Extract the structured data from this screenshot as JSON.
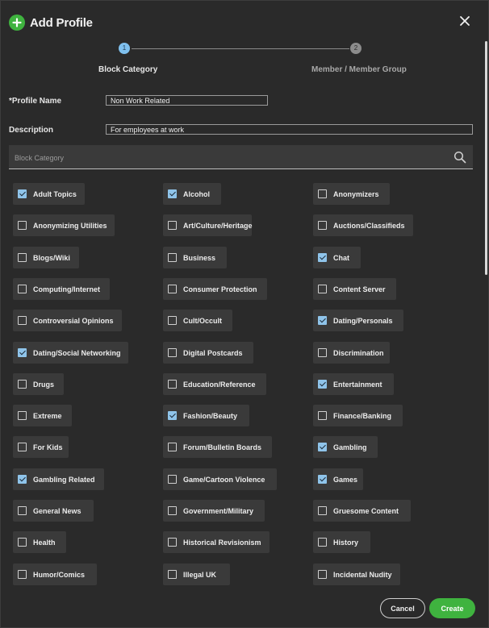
{
  "header": {
    "title": "Add Profile",
    "icon": "plus-icon",
    "accent": "#3fb33f"
  },
  "stepper": {
    "steps": [
      {
        "number": "1",
        "label": "Block Category",
        "active": true
      },
      {
        "number": "2",
        "label": "Member / Member Group",
        "active": false
      }
    ]
  },
  "form": {
    "profile_name_label": "*Profile Name",
    "profile_name_value": "Non Work Related",
    "description_label": "Description",
    "description_value": "For employees at work",
    "search_placeholder": "Block Category"
  },
  "categories": [
    {
      "label": "Adult Topics",
      "checked": true
    },
    {
      "label": "Alcohol",
      "checked": true
    },
    {
      "label": "Anonymizers",
      "checked": false
    },
    {
      "label": "Anonymizing Utilities",
      "checked": false
    },
    {
      "label": "Art/Culture/Heritage",
      "checked": false
    },
    {
      "label": "Auctions/Classifieds",
      "checked": false
    },
    {
      "label": "Blogs/Wiki",
      "checked": false
    },
    {
      "label": "Business",
      "checked": false
    },
    {
      "label": "Chat",
      "checked": true
    },
    {
      "label": "Computing/Internet",
      "checked": false
    },
    {
      "label": "Consumer Protection",
      "checked": false
    },
    {
      "label": "Content Server",
      "checked": false
    },
    {
      "label": "Controversial Opinions",
      "checked": false
    },
    {
      "label": "Cult/Occult",
      "checked": false
    },
    {
      "label": "Dating/Personals",
      "checked": true
    },
    {
      "label": "Dating/Social Networking",
      "checked": true
    },
    {
      "label": "Digital Postcards",
      "checked": false
    },
    {
      "label": "Discrimination",
      "checked": false
    },
    {
      "label": "Drugs",
      "checked": false
    },
    {
      "label": "Education/Reference",
      "checked": false
    },
    {
      "label": "Entertainment",
      "checked": true
    },
    {
      "label": "Extreme",
      "checked": false
    },
    {
      "label": "Fashion/Beauty",
      "checked": true
    },
    {
      "label": "Finance/Banking",
      "checked": false
    },
    {
      "label": "For Kids",
      "checked": false
    },
    {
      "label": "Forum/Bulletin Boards",
      "checked": false
    },
    {
      "label": "Gambling",
      "checked": true
    },
    {
      "label": "Gambling Related",
      "checked": true
    },
    {
      "label": "Game/Cartoon Violence",
      "checked": false
    },
    {
      "label": "Games",
      "checked": true
    },
    {
      "label": "General News",
      "checked": false
    },
    {
      "label": "Government/Military",
      "checked": false
    },
    {
      "label": "Gruesome Content",
      "checked": false
    },
    {
      "label": "Health",
      "checked": false
    },
    {
      "label": "Historical Revisionism",
      "checked": false
    },
    {
      "label": "History",
      "checked": false
    },
    {
      "label": "Humor/Comics",
      "checked": false
    },
    {
      "label": "Illegal UK",
      "checked": false
    },
    {
      "label": "Incidental Nudity",
      "checked": false
    }
  ],
  "footer": {
    "cancel_label": "Cancel",
    "create_label": "Create"
  },
  "colors": {
    "checkbox_checked": "#8fc4ea",
    "background": "#2a2a2a",
    "chip": "#3a3a3a"
  }
}
